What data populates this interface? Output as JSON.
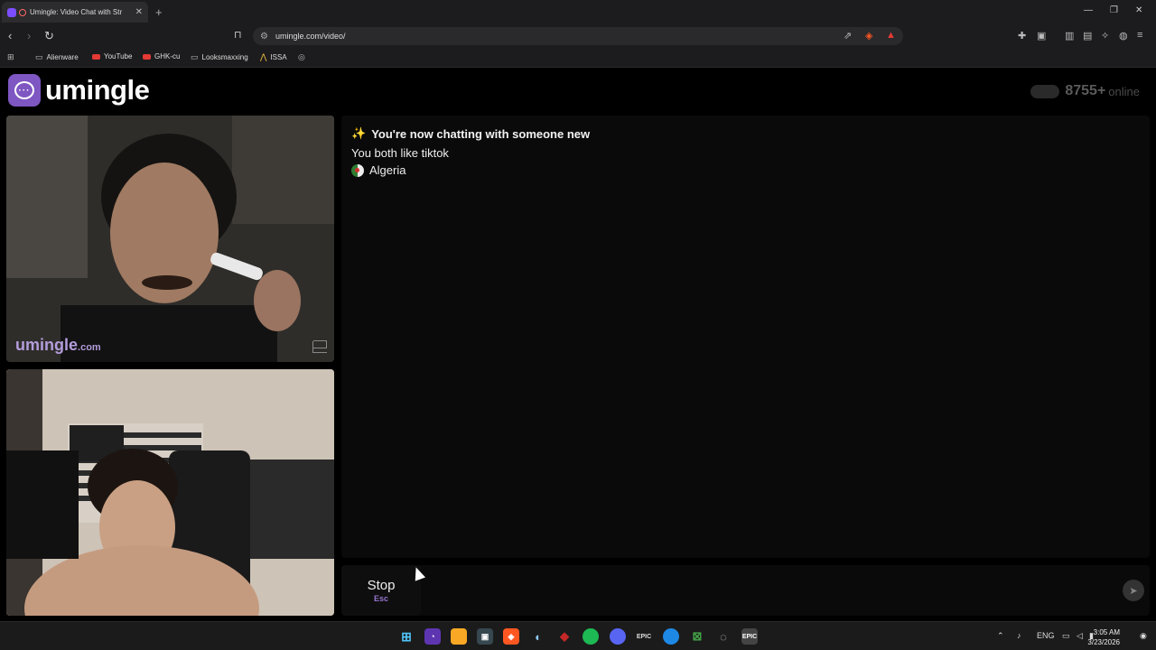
{
  "browser": {
    "tab_title": "Umingle: Video Chat with Str",
    "new_tab": "+",
    "url": "umingle.com/video/",
    "bookmarks": [
      "Alienware",
      "YouTube",
      "GHK-cu",
      "Looksmaxxing",
      "ISSA"
    ]
  },
  "site": {
    "logo_text": "umingle",
    "online_count": "8755+",
    "online_label": "online",
    "watermark": "umingle",
    "watermark_suffix": ".com"
  },
  "chat": {
    "status_line": "You're now chatting with someone new",
    "interest_line": "You both like tiktok",
    "country": "Algeria"
  },
  "controls": {
    "stop_label": "Stop",
    "stop_key": "Esc",
    "message_placeholder": ""
  },
  "taskbar": {
    "lang": "ENG",
    "time": "3:05 AM",
    "date": "3/23/2026"
  },
  "colors": {
    "accent": "#7e57c2",
    "watermark": "#b39ddb"
  }
}
